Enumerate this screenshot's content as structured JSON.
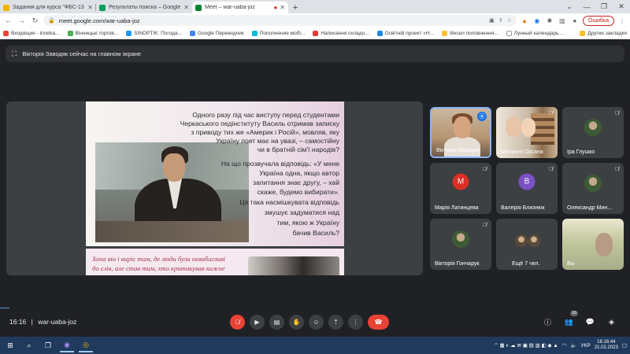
{
  "browser": {
    "tabs": [
      {
        "title": "Задания для курса \"ФБС-13 УК\"",
        "favicon_color": "#f4b400",
        "active": false
      },
      {
        "title": "Результаты поиска – Google Ди",
        "favicon_color": "#0f9d58",
        "active": false
      },
      {
        "title": "Meet – war-uaba-joz",
        "favicon_color": "#00832d",
        "active": true
      }
    ],
    "new_tab_glyph": "+",
    "url": "meet.google.com/war-uaba-joz",
    "error_button": "Ошибка",
    "bookmarks": [
      {
        "label": "Входящие - inneba...",
        "color": "#ea4335"
      },
      {
        "label": "Вінницькі торгов...",
        "color": "#4caf50"
      },
      {
        "label": "SINOPTIK: Погода...",
        "color": "#2196f3"
      },
      {
        "label": "Google Переводчик",
        "color": "#4285f4"
      },
      {
        "label": "Пополнение мобі...",
        "color": "#00bcd4"
      },
      {
        "label": "Написання складн...",
        "color": "#e53935"
      },
      {
        "label": "Освітній проект «Н...",
        "color": "#1e88e5"
      },
      {
        "label": "Ійксел поповнення...",
        "color": "#fbc02d"
      },
      {
        "label": "Лунный календарь...",
        "color": "#ffffff"
      }
    ],
    "bookmarks_other": "Другие закладки"
  },
  "meet": {
    "presenter_banner": "Вікторія Заводяк сейчас на главном экране",
    "slide": {
      "top_lines": [
        "Одного разу під час виступу перед студентами",
        "Черкаського педінституту Василь отримав записку",
        "з приводу тих же «Америк і Росій», мовляв, яку",
        "Україну поет має на увазі, – самостійну",
        "чи в братній сім'ї народів?",
        "На що прозвучала відповідь: «У мене",
        "Україна одна, якщо автор",
        "запитання знає другу, – хай",
        "скаже, будемо вибирати».",
        "Ця така насмішкувата відповідь",
        "змушує задуматися над",
        "тим, якою ж Україну",
        "бачив Василь?"
      ],
      "bottom_lines": [
        "Хоча він і виріс там, де люди були невибагливі",
        "до слів, але став тим, хто критикував кожне"
      ]
    },
    "participants": [
      {
        "name": "Вікторія Заводяк",
        "type": "video",
        "speaking": true
      },
      {
        "name": "Мельник Оксана",
        "type": "video",
        "muted": true
      },
      {
        "name": "Іра Глушко",
        "type": "photo",
        "muted": true
      },
      {
        "name": "Марія Латинцева",
        "type": "initial",
        "initial": "М",
        "color": "#d93025",
        "muted": true
      },
      {
        "name": "Валерія Близнюк",
        "type": "initial",
        "initial": "В",
        "color": "#7b52c4",
        "muted": true
      },
      {
        "name": "Олександр Мин...",
        "type": "photo",
        "muted": true
      },
      {
        "name": "Вікторія Гончарук",
        "type": "photo",
        "muted": true
      },
      {
        "name": "Ещё 7 чел.",
        "type": "group"
      },
      {
        "name": "Вы",
        "type": "video",
        "muted": true
      }
    ],
    "time": "16:16",
    "meeting_code": "war-uaba-joz",
    "participants_count": "16"
  },
  "taskbar": {
    "keyboard_lang": "УКР",
    "clock_time": "16:16:44",
    "clock_date": "21.02.2023"
  }
}
